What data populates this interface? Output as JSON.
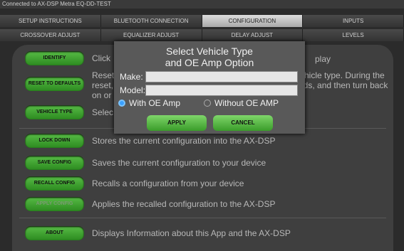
{
  "window": {
    "title": "Connected to AX-DSP Metra EQ-DD-TEST"
  },
  "tabs_row1": [
    {
      "label": "SETUP INSTRUCTIONS",
      "active": false
    },
    {
      "label": "BLUETOOTH CONNECTION",
      "active": false
    },
    {
      "label": "CONFIGURATION",
      "active": true
    },
    {
      "label": "INPUTS",
      "active": false
    }
  ],
  "tabs_row2": [
    {
      "label": "CROSSOVER ADJUST"
    },
    {
      "label": "EQUALIZER ADJUST"
    },
    {
      "label": "DELAY ADJUST"
    },
    {
      "label": "LEVELS"
    }
  ],
  "items": [
    {
      "button": "IDENTIFY",
      "desc": "Click"
    },
    {
      "button": "RESET TO DEFAULTS",
      "desc": "Reset",
      "desc2": "reset,",
      "desc3": "on or"
    },
    {
      "button": "VEHICLE TYPE",
      "desc": "Selec"
    },
    {
      "button": "LOCK DOWN",
      "desc": "Stores the current configuration into the AX-DSP"
    },
    {
      "button": "SAVE CONFIG",
      "desc": "Saves the current configuration to your device"
    },
    {
      "button": "RECALL CONFIG",
      "desc": "Recalls a configuration from your device"
    },
    {
      "button": "APPLY CONFIG",
      "desc": "Applies the recalled configuration to the AX-DSP"
    },
    {
      "button": "ABOUT",
      "desc": "Displays Information about this App and the AX-DSP"
    }
  ],
  "behind": {
    "r1": "play",
    "r2": "hicle type. During the",
    "r3": "nds, and then turn back"
  },
  "dialog": {
    "title_line1": "Select Vehicle Type",
    "title_line2": "and OE Amp Option",
    "make_label": "Make:",
    "model_label": "Model:",
    "radio_with": "With OE Amp",
    "radio_without": "Without OE AMP",
    "apply": "APPLY",
    "cancel": "CANCEL"
  },
  "colors": {
    "accent_green": "#3a9c2a",
    "radio_blue": "#3aa0ff"
  }
}
